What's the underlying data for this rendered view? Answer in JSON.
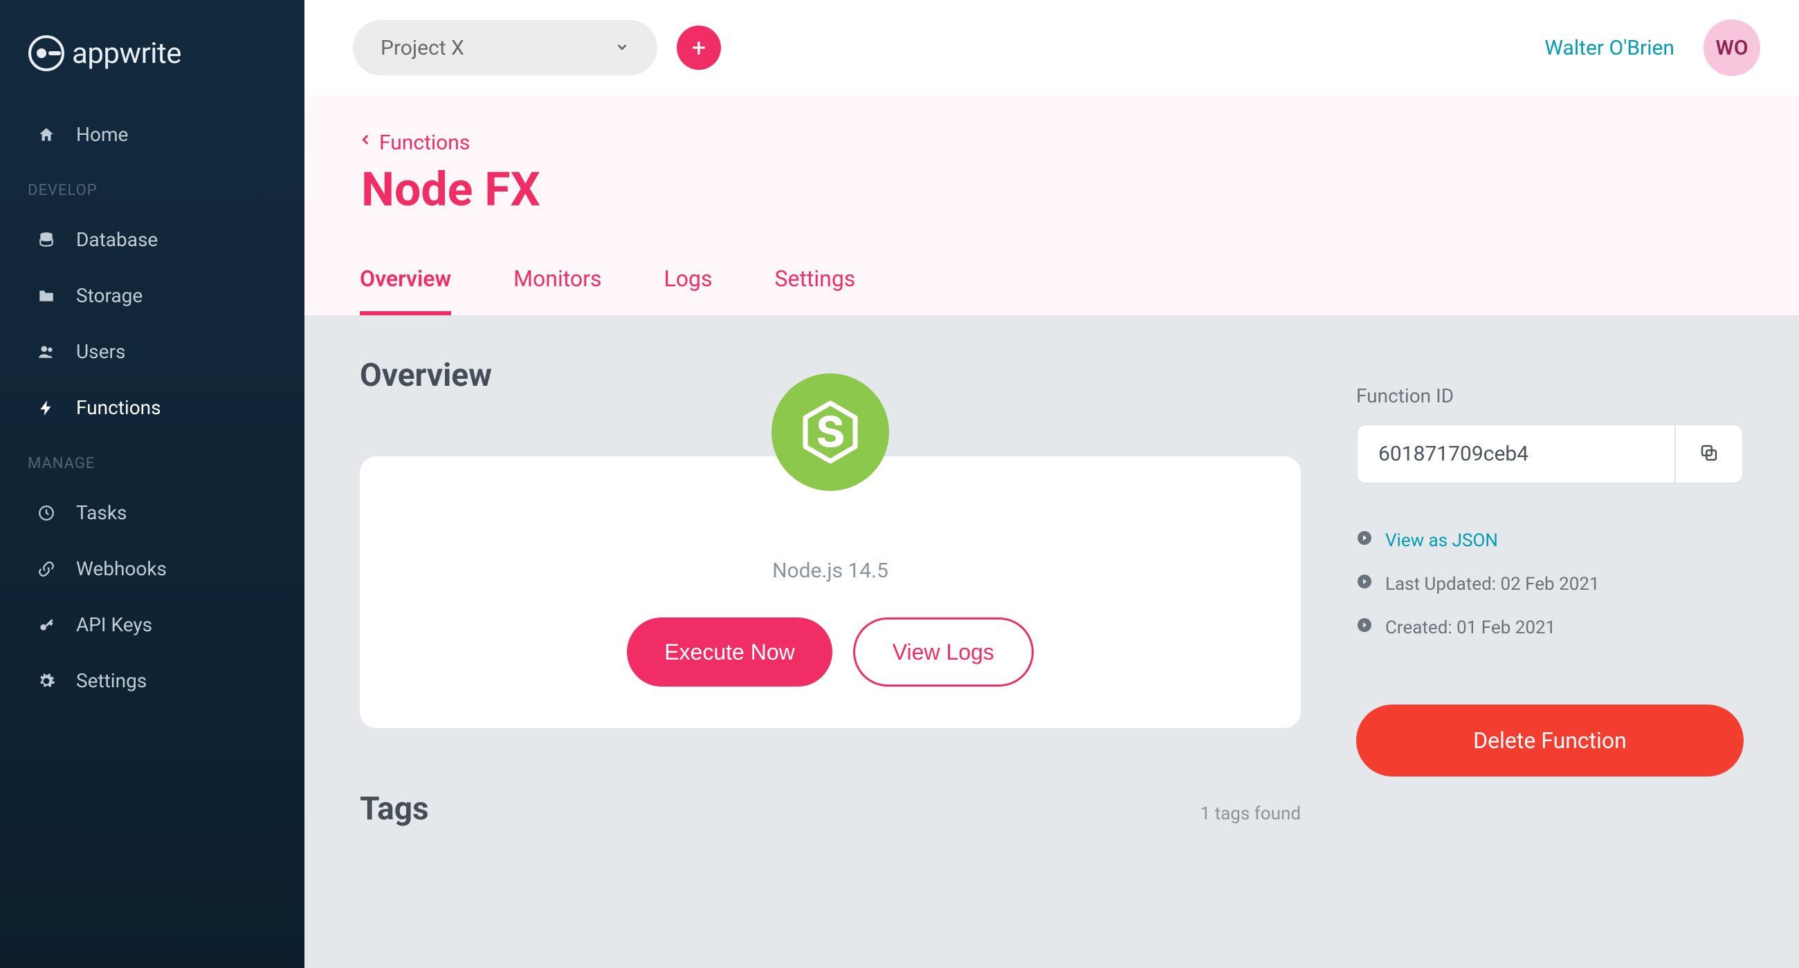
{
  "brand": {
    "name": "appwrite"
  },
  "topbar": {
    "project": "Project X",
    "user_name": "Walter O'Brien",
    "avatar_initials": "WO"
  },
  "sidebar": {
    "items": [
      {
        "label": "Home"
      }
    ],
    "develop_label": "DEVELOP",
    "develop": [
      {
        "label": "Database"
      },
      {
        "label": "Storage"
      },
      {
        "label": "Users"
      },
      {
        "label": "Functions"
      }
    ],
    "manage_label": "MANAGE",
    "manage": [
      {
        "label": "Tasks"
      },
      {
        "label": "Webhooks"
      },
      {
        "label": "API Keys"
      },
      {
        "label": "Settings"
      }
    ]
  },
  "page": {
    "breadcrumb": "Functions",
    "title": "Node FX",
    "tabs": [
      {
        "label": "Overview",
        "active": true
      },
      {
        "label": "Monitors"
      },
      {
        "label": "Logs"
      },
      {
        "label": "Settings"
      }
    ],
    "overview_heading": "Overview",
    "runtime": "Node.js 14.5",
    "execute_label": "Execute Now",
    "view_logs_label": "View Logs",
    "function_id_label": "Function ID",
    "function_id": "601871709ceb4",
    "view_json": "View as JSON",
    "last_updated": "Last Updated: 02 Feb 2021",
    "created": "Created: 01 Feb 2021",
    "delete_label": "Delete Function",
    "tags_heading": "Tags",
    "tags_count": "1 tags found"
  }
}
